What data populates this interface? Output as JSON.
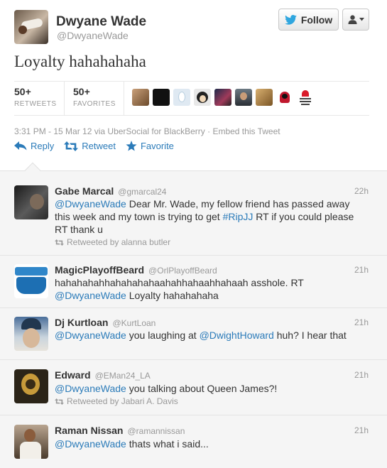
{
  "author": {
    "name": "Dwyane Wade",
    "handle": "@DwyaneWade"
  },
  "buttons": {
    "follow": "Follow"
  },
  "tweet": {
    "text": "Loyalty hahahahaha"
  },
  "stats": {
    "retweets": {
      "count": "50+",
      "label": "RETWEETS"
    },
    "favorites": {
      "count": "50+",
      "label": "FAVORITES"
    }
  },
  "meta": {
    "timestamp": "3:31 PM - 15 Mar 12",
    "via": " via UberSocial for BlackBerry",
    "sep": " · ",
    "embed": "Embed this Tweet"
  },
  "actions": {
    "reply": "Reply",
    "retweet": "Retweet",
    "favorite": "Favorite"
  },
  "replies": [
    {
      "name": "Gabe Marcal",
      "handle": "@gmarcal24",
      "time": "22h",
      "parts": [
        "@DwyaneWade",
        " Dear Mr. Wade, my fellow friend has passed away this week and my town is trying to get ",
        "#RipJJ",
        " RT if you could please RT thank u"
      ],
      "retweeted_by": "Retweeted by alanna butler"
    },
    {
      "name": "MagicPlayoffBeard",
      "handle": "@OrlPlayoffBeard",
      "time": "21h",
      "parts": [
        "hahahahahhahahahahaahahhahaahhahaah asshole. RT ",
        "@DwyaneWade",
        " Loyalty hahahahaha"
      ]
    },
    {
      "name": "Dj Kurtloan",
      "handle": "@KurtLoan",
      "time": "21h",
      "parts": [
        "@DwyaneWade",
        " you laughing at ",
        "@DwightHoward",
        " huh? I hear that"
      ]
    },
    {
      "name": "Edward",
      "handle": "@EMan24_LA",
      "time": "21h",
      "parts": [
        "@DwyaneWade",
        " you talking about Queen James?!"
      ],
      "retweeted_by": "Retweeted by Jabari A. Davis"
    },
    {
      "name": "Raman Nissan",
      "handle": "@ramannissan",
      "time": "21h",
      "parts": [
        "@DwyaneWade",
        " thats what i said..."
      ]
    }
  ],
  "colors": {
    "link": "#2b7bb9",
    "muted": "#999999",
    "reply_bg": "#f5f5f5"
  },
  "icons": [
    "twitter-bird-icon",
    "user-icon",
    "chevron-down-icon",
    "reply-icon",
    "retweet-icon",
    "star-icon"
  ]
}
